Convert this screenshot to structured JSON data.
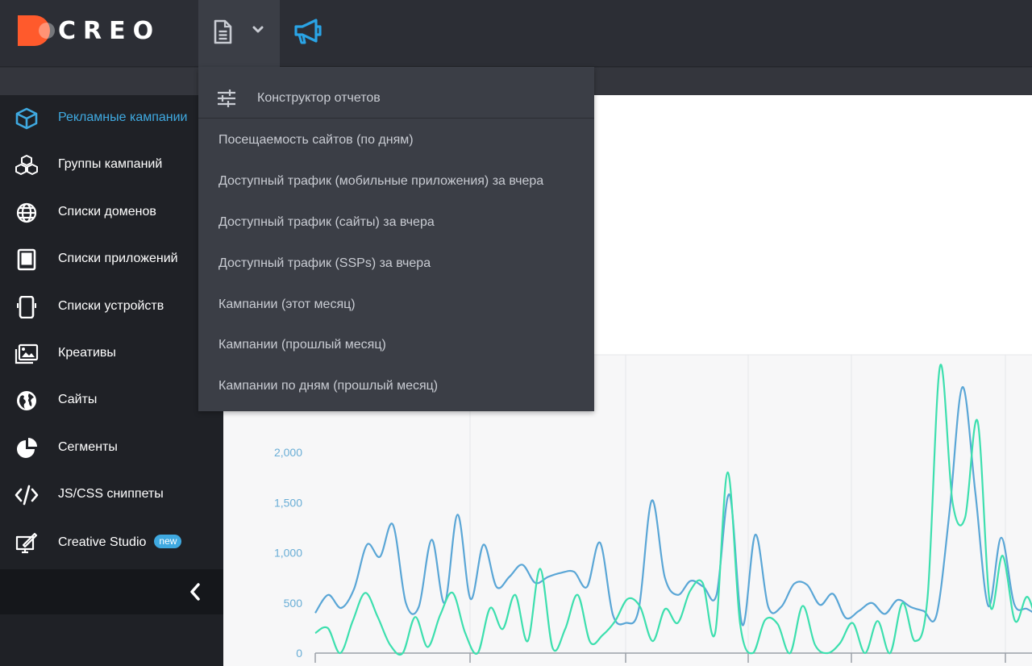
{
  "header": {
    "logo_text": "CREO",
    "logo_color": "#ff5a2c",
    "accent_color": "#3fa9e0",
    "reports_icon": "document-icon",
    "dropdown_icon": "chevron-down-icon",
    "announcements_icon": "megaphone-icon"
  },
  "sidebar": {
    "items": [
      {
        "label": "Рекламные кампании",
        "icon": "cube-icon",
        "active": true
      },
      {
        "label": "Группы кампаний",
        "icon": "cubes-icon"
      },
      {
        "label": "Списки доменов",
        "icon": "globe-icon"
      },
      {
        "label": "Списки приложений",
        "icon": "tablet-icon"
      },
      {
        "label": "Списки устройств",
        "icon": "device-icon"
      },
      {
        "label": "Креативы",
        "icon": "images-icon"
      },
      {
        "label": "Сайты",
        "icon": "earth-icon"
      },
      {
        "label": "Сегменты",
        "icon": "pie-chart-icon"
      },
      {
        "label": "JS/CSS сниппеты",
        "icon": "code-icon"
      },
      {
        "label": "Creative Studio",
        "icon": "studio-icon",
        "badge": "new"
      }
    ],
    "collapse_icon": "chevron-left-icon"
  },
  "reports_menu": {
    "header": "Конструктор отчетов",
    "header_icon": "sliders-icon",
    "items": [
      "Посещаемость сайтов (по дням)",
      "Доступный трафик (мобильные приложения) за вчера",
      "Доступный трафик (сайты) за вчера",
      "Доступный трафик (SSPs) за вчера",
      "Кампании (этот месяц)",
      "Кампании (прошлый месяц)",
      "Кампании по дням (прошлый месяц)"
    ]
  },
  "chart_data": {
    "type": "line",
    "y_ticks": [
      "2,000",
      "1,500",
      "1,000",
      "500",
      "0"
    ],
    "ylim": [
      0,
      2700
    ],
    "grid": true,
    "series": [
      {
        "color": "#5aa6d6",
        "values": [
          400,
          580,
          450,
          640,
          1080,
          960,
          1280,
          500,
          460,
          1130,
          500,
          1380,
          540,
          1080,
          660,
          760,
          880,
          700,
          760,
          800,
          810,
          660,
          1100,
          380,
          300,
          440,
          1520,
          760,
          580,
          720,
          660,
          580,
          1580,
          280,
          1180,
          460,
          460,
          690,
          680,
          480,
          590,
          350,
          420,
          500,
          390,
          530,
          460,
          420,
          380,
          1400,
          2650,
          1600,
          470,
          1150,
          490,
          440,
          360
        ],
        "series_colors": "blue"
      },
      {
        "color": "#3ddfae",
        "values": [
          200,
          250,
          0,
          320,
          600,
          360,
          80,
          0,
          360,
          60,
          380,
          600,
          200,
          0,
          450,
          240,
          580,
          120,
          840,
          50,
          240,
          580,
          110,
          180,
          320,
          540,
          460,
          120,
          440,
          300,
          620,
          700,
          200,
          1800,
          290,
          0,
          330,
          290,
          0,
          470,
          80,
          0,
          100,
          300,
          0,
          320,
          0,
          500,
          120,
          560,
          2860,
          1500,
          1350,
          2310,
          480,
          970,
          320,
          560,
          160
        ]
      }
    ]
  }
}
